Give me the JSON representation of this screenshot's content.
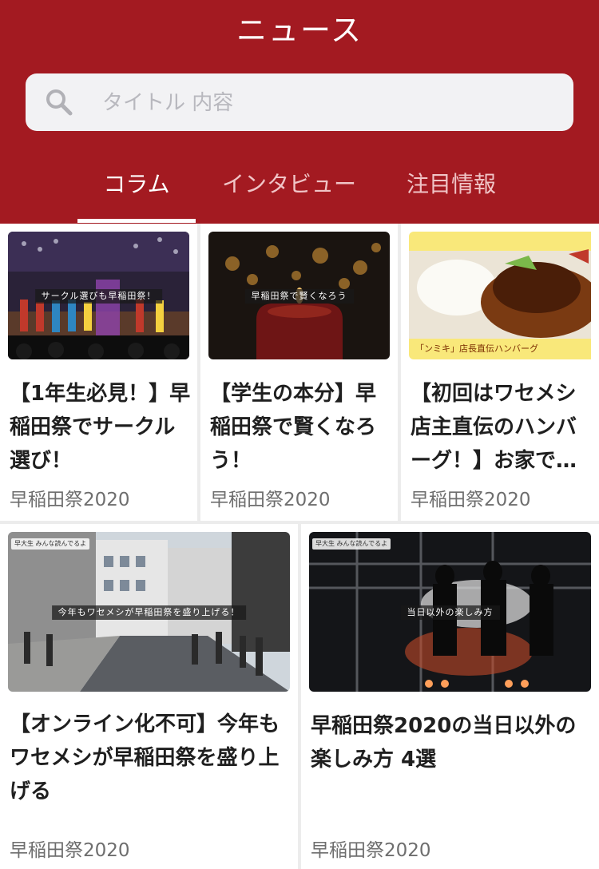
{
  "header": {
    "title": "ニュース",
    "search_placeholder": "タイトル 内容",
    "tabs": [
      {
        "label": "コラム",
        "active": true
      },
      {
        "label": "インタビュー",
        "active": false
      },
      {
        "label": "注目情報",
        "active": false
      }
    ]
  },
  "colors": {
    "header_bg": "#a31a21",
    "tab_inactive": "#f0c4c6"
  },
  "articles": [
    {
      "title": "【1年生必見！】早稲田祭でサークル選び！",
      "tag": "早稲田祭2020",
      "thumb_caption": "サークル選びも早稲田祭！",
      "thumb_badge": "",
      "image_desc": "stage-performance"
    },
    {
      "title": "【学生の本分】早稲田祭で賢くなろう！",
      "tag": "早稲田祭2020",
      "thumb_caption": "早稲田祭で賢くなろう",
      "thumb_badge": "",
      "image_desc": "candles"
    },
    {
      "title": "【初回はワセメシ店主直伝のハンバーグ！】お家で…",
      "tag": "早稲田祭2020",
      "thumb_caption": "「ンミキ」店長直伝ハンバーグ",
      "thumb_badge": "",
      "image_desc": "hamburger-steak"
    },
    {
      "title": "【オンライン化不可】今年もワセメシが早稲田祭を盛り上げる",
      "tag": "早稲田祭2020",
      "thumb_caption": "今年もワセメシが早稲田祭を盛り上げる！",
      "thumb_badge": "早大生 みんな読んでるよ",
      "image_desc": "street-crowd"
    },
    {
      "title": "早稲田祭2020の当日以外の楽しみ方 4選",
      "tag": "早稲田祭2020",
      "thumb_caption": "当日以外の楽しみ方",
      "thumb_badge": "早大生 みんな読んでるよ",
      "image_desc": "night-stage"
    }
  ]
}
